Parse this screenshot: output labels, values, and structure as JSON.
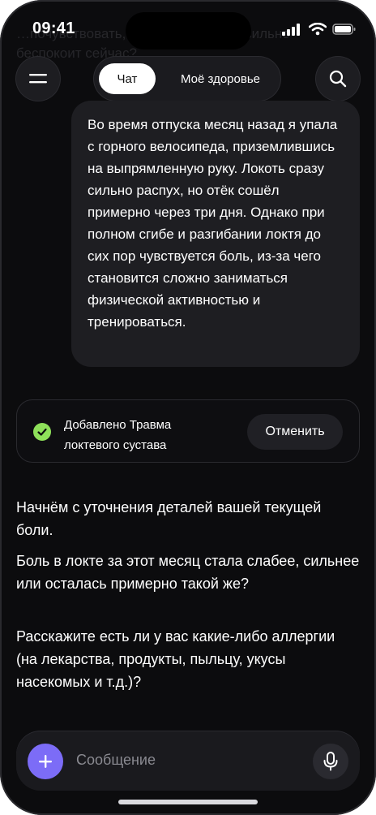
{
  "status": {
    "time": "09:41"
  },
  "background_text": "…почувствовать, что она как будто сильно беспокоит сейчас?",
  "tabs": {
    "chat": "Чат",
    "health": "Моё здоровье"
  },
  "user_message": "Во время отпуска месяц назад я упала с горного велосипеда, приземлившись на выпрямленную руку. Локоть сразу сильно распух, но отёк сошёл примерно через три дня. Однако при полном сгибе и разгибании локтя до сих пор чувствуется боль, из-за чего становится сложно заниматься физической активностью и тренироваться.",
  "added_card": {
    "text": "Добавлено Травма локтевого сустава",
    "cancel_label": "Отменить",
    "accent": "#8ee05a"
  },
  "assistant": {
    "p1": "Начнём с уточнения деталей вашей текущей боли.",
    "p2": "Боль в локте за этот месяц стала слабее, сильнее или осталась примерно такой же?",
    "p3": "Расскажите есть ли у вас какие-либо аллергии (на лекарства, продукты, пыльцу, укусы насекомых и т.д.)?"
  },
  "composer": {
    "placeholder": "Сообщение",
    "accent": "#7c6cf7"
  },
  "icons": {
    "menu": "menu-icon",
    "search": "search-icon",
    "plus": "plus-icon",
    "mic": "microphone-icon",
    "check": "check-icon"
  }
}
